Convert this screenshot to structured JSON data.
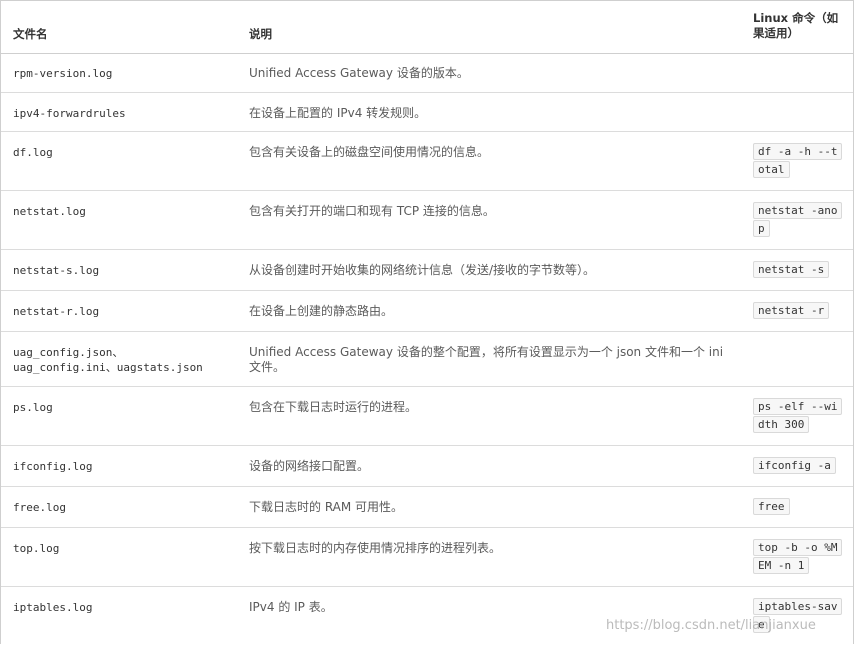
{
  "table": {
    "headers": {
      "file": "文件名",
      "desc": "说明",
      "cmd": "Linux 命令（如果适用）"
    },
    "rows": [
      {
        "file": "rpm-version.log",
        "desc": "Unified Access Gateway 设备的版本。",
        "cmd": ""
      },
      {
        "file": "ipv4-forwardrules",
        "desc": "在设备上配置的 IPv4 转发规则。",
        "cmd": ""
      },
      {
        "file": "df.log",
        "desc": "包含有关设备上的磁盘空间使用情况的信息。",
        "cmd": "df -a -h --total"
      },
      {
        "file": "netstat.log",
        "desc": "包含有关打开的端口和现有 TCP 连接的信息。",
        "cmd": "netstat -anop"
      },
      {
        "file": "netstat-s.log",
        "desc": "从设备创建时开始收集的网络统计信息（发送/接收的字节数等）。",
        "cmd": "netstat -s"
      },
      {
        "file": "netstat-r.log",
        "desc": "在设备上创建的静态路由。",
        "cmd": "netstat -r"
      },
      {
        "file": "uag_config.json、\nuag_config.ini、uagstats.json",
        "desc": "Unified Access Gateway 设备的整个配置，将所有设置显示为一个 json 文件和一个 ini 文件。",
        "cmd": ""
      },
      {
        "file": "ps.log",
        "desc": "包含在下载日志时运行的进程。",
        "cmd": "ps -elf --width 300"
      },
      {
        "file": "ifconfig.log",
        "desc": "设备的网络接口配置。",
        "cmd": "ifconfig -a"
      },
      {
        "file": "free.log",
        "desc": "下载日志时的 RAM 可用性。",
        "cmd": "free"
      },
      {
        "file": "top.log",
        "desc": "按下载日志时的内存使用情况排序的进程列表。",
        "cmd": "top -b -o %MEM -n 1"
      },
      {
        "file": "iptables.log",
        "desc": "IPv4 的 IP 表。",
        "cmd": "iptables-save"
      }
    ]
  },
  "watermark": "https://blog.csdn.net/lianjianxue"
}
